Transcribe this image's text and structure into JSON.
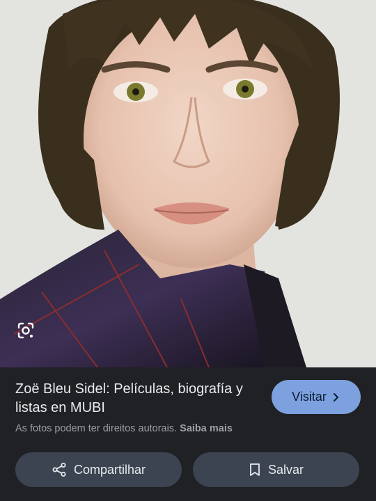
{
  "result": {
    "title": "Zoë Bleu Sidel: Películas, biografía y listas en MUBI",
    "visit_label": "Visitar",
    "copyright_text": "As fotos podem ter direitos autorais.",
    "learn_more": "Saiba mais"
  },
  "actions": {
    "share_label": "Compartilhar",
    "save_label": "Salvar"
  },
  "icons": {
    "lens": "google-lens-icon",
    "chevron": "chevron-right-icon",
    "share": "share-icon",
    "bookmark": "bookmark-icon"
  },
  "colors": {
    "background": "#202124",
    "visit_button": "#7ca1de",
    "action_button": "#3c4351",
    "text_primary": "#e8eaed",
    "text_secondary": "#9aa0a6"
  }
}
